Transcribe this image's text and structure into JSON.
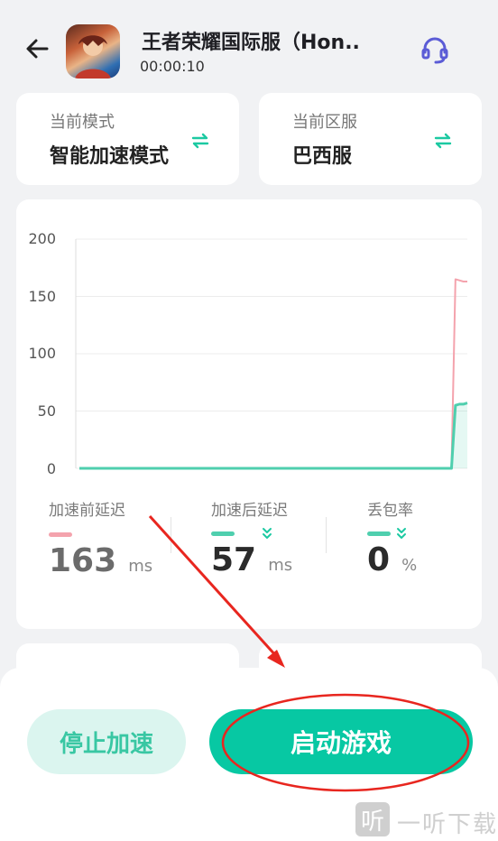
{
  "header": {
    "title": "王者荣耀国际服（Hon..",
    "timer": "00:00:10",
    "back_icon": "arrow-left-icon",
    "support_icon": "headset-icon"
  },
  "mode_card": {
    "label": "当前模式",
    "value": "智能加速模式",
    "icon": "swap-icon"
  },
  "region_card": {
    "label": "当前区服",
    "value": "巴西服",
    "icon": "swap-icon"
  },
  "chart_data": {
    "type": "line",
    "y_ticks": [
      "200",
      "150",
      "100",
      "50",
      "0"
    ],
    "ylim": [
      0,
      200
    ],
    "grid": true,
    "series": [
      {
        "name": "加速前延迟",
        "color": "#f4a3ad",
        "values": [
          0,
          0,
          0,
          0,
          0,
          0,
          0,
          0,
          0,
          0,
          0,
          0,
          0,
          0,
          0,
          0,
          0,
          0,
          0,
          0,
          0,
          0,
          0,
          0,
          0,
          0,
          0,
          0,
          0,
          0,
          0,
          0,
          0,
          0,
          0,
          0,
          0,
          0,
          0,
          0,
          0,
          0,
          0,
          0,
          0,
          0,
          0,
          0,
          0,
          0,
          0,
          0,
          0,
          0,
          0,
          0,
          0,
          0,
          0,
          0,
          0,
          0,
          0,
          0,
          0,
          0,
          0,
          0,
          0,
          0,
          0,
          0,
          0,
          0,
          0,
          0,
          0,
          0,
          0,
          0,
          0,
          0,
          0,
          0,
          0,
          0,
          0,
          0,
          0,
          0,
          0,
          0,
          0,
          0,
          0,
          165,
          164,
          163,
          163
        ]
      },
      {
        "name": "加速后延迟",
        "color": "#4fcfae",
        "values": [
          0,
          0,
          0,
          0,
          0,
          0,
          0,
          0,
          0,
          0,
          0,
          0,
          0,
          0,
          0,
          0,
          0,
          0,
          0,
          0,
          0,
          0,
          0,
          0,
          0,
          0,
          0,
          0,
          0,
          0,
          0,
          0,
          0,
          0,
          0,
          0,
          0,
          0,
          0,
          0,
          0,
          0,
          0,
          0,
          0,
          0,
          0,
          0,
          0,
          0,
          0,
          0,
          0,
          0,
          0,
          0,
          0,
          0,
          0,
          0,
          0,
          0,
          0,
          0,
          0,
          0,
          0,
          0,
          0,
          0,
          0,
          0,
          0,
          0,
          0,
          0,
          0,
          0,
          0,
          0,
          0,
          0,
          0,
          0,
          0,
          0,
          0,
          0,
          0,
          0,
          0,
          0,
          0,
          0,
          0,
          55,
          56,
          56,
          57
        ]
      }
    ]
  },
  "stats": [
    {
      "label": "加速前延迟",
      "value": "163",
      "unit": "ms",
      "color": "#f4a3ad",
      "value_color": "#6b6b6b",
      "arrow": false
    },
    {
      "label": "加速后延迟",
      "value": "57",
      "unit": "ms",
      "color": "#4fcfae",
      "value_color": "#2b2b2b",
      "arrow": true
    },
    {
      "label": "丢包率",
      "value": "0",
      "unit": "%",
      "color": "#4fcfae",
      "value_color": "#2b2b2b",
      "arrow": true
    }
  ],
  "buttons": {
    "stop": "停止加速",
    "start": "启动游戏"
  },
  "watermark": {
    "glyph": "听",
    "text": "一听下载"
  }
}
